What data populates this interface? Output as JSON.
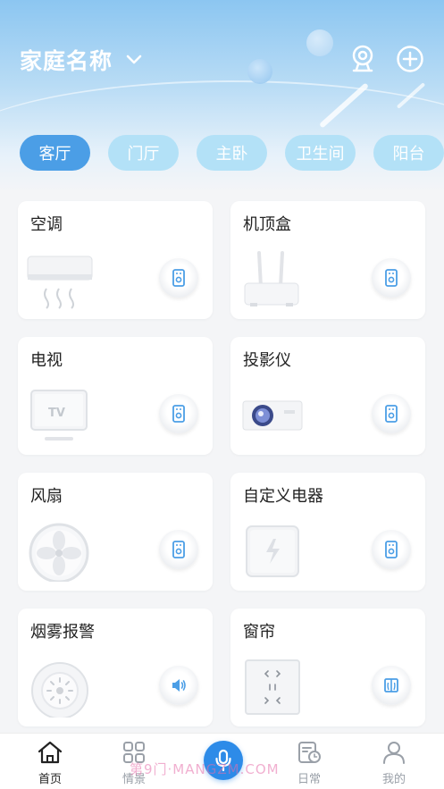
{
  "header": {
    "home_name": "家庭名称"
  },
  "rooms": [
    "客厅",
    "门厅",
    "主卧",
    "卫生间",
    "阳台"
  ],
  "active_room_index": 0,
  "devices": [
    {
      "name": "空调",
      "icon": "air-conditioner",
      "control": "remote"
    },
    {
      "name": "机顶盒",
      "icon": "set-top-box",
      "control": "remote"
    },
    {
      "name": "电视",
      "icon": "tv",
      "control": "remote"
    },
    {
      "name": "投影仪",
      "icon": "projector",
      "control": "remote"
    },
    {
      "name": "风扇",
      "icon": "fan",
      "control": "remote"
    },
    {
      "name": "自定义电器",
      "icon": "custom-appliance",
      "control": "remote"
    },
    {
      "name": "烟雾报警",
      "icon": "smoke-alarm",
      "control": "speaker"
    },
    {
      "name": "窗帘",
      "icon": "curtain",
      "control": "curtain"
    }
  ],
  "tv_screen_text": "TV",
  "tabbar": {
    "home": "首页",
    "scene": "情景",
    "daily": "日常",
    "mine": "我的"
  },
  "watermark": "第9门·MANGZM.COM",
  "colors": {
    "accent": "#2d8be8",
    "tab_active": "#4b9ee6",
    "tab_inactive": "#b3e1f7"
  }
}
